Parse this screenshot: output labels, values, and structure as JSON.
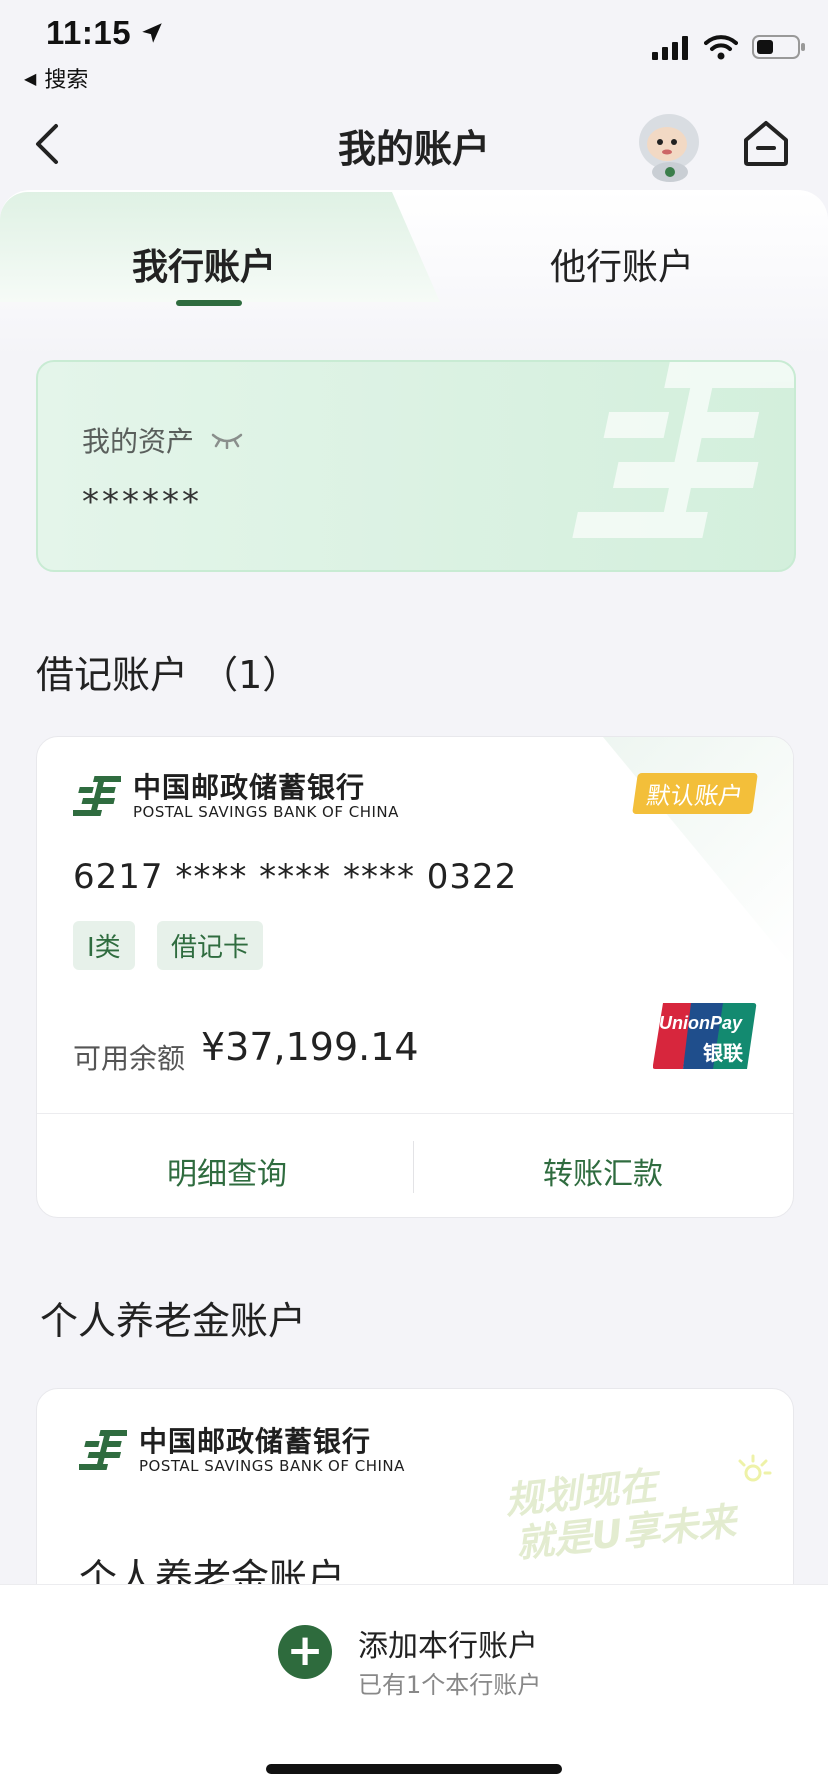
{
  "status_bar": {
    "time": "11:15",
    "back_app": "搜索"
  },
  "nav": {
    "title": "我的账户"
  },
  "tabs": [
    {
      "label": "我行账户",
      "active": true
    },
    {
      "label": "他行账户",
      "active": false
    }
  ],
  "assets": {
    "label": "我的资产",
    "value": "******"
  },
  "debit_section": {
    "title": "借记账户 （1）"
  },
  "debit_card": {
    "bank_cn": "中国邮政储蓄银行",
    "bank_en": "POSTAL SAVINGS BANK OF CHINA",
    "default_badge": "默认账户",
    "card_number": "6217 **** **** **** 0322",
    "tags": [
      "I类",
      "借记卡"
    ],
    "balance_label": "可用余额",
    "balance_value": "¥37,199.14",
    "unionpay_en": "UnionPay",
    "unionpay_cn": "银联",
    "actions": [
      "明细查询",
      "转账汇款"
    ]
  },
  "pension_section": {
    "title": "个人养老金账户"
  },
  "pension_card": {
    "bank_cn": "中国邮政储蓄银行",
    "bank_en": "POSTAL SAVINGS BANK OF CHINA",
    "slogan_line1": "规划现在",
    "slogan_line2": "就是U享未来",
    "account_title": "个人养老金账户"
  },
  "bottom_bar": {
    "title": "添加本行账户",
    "subtitle": "已有1个本行账户"
  },
  "colors": {
    "accent_green": "#2f6c3f",
    "badge_yellow": "#f3bf3a"
  }
}
